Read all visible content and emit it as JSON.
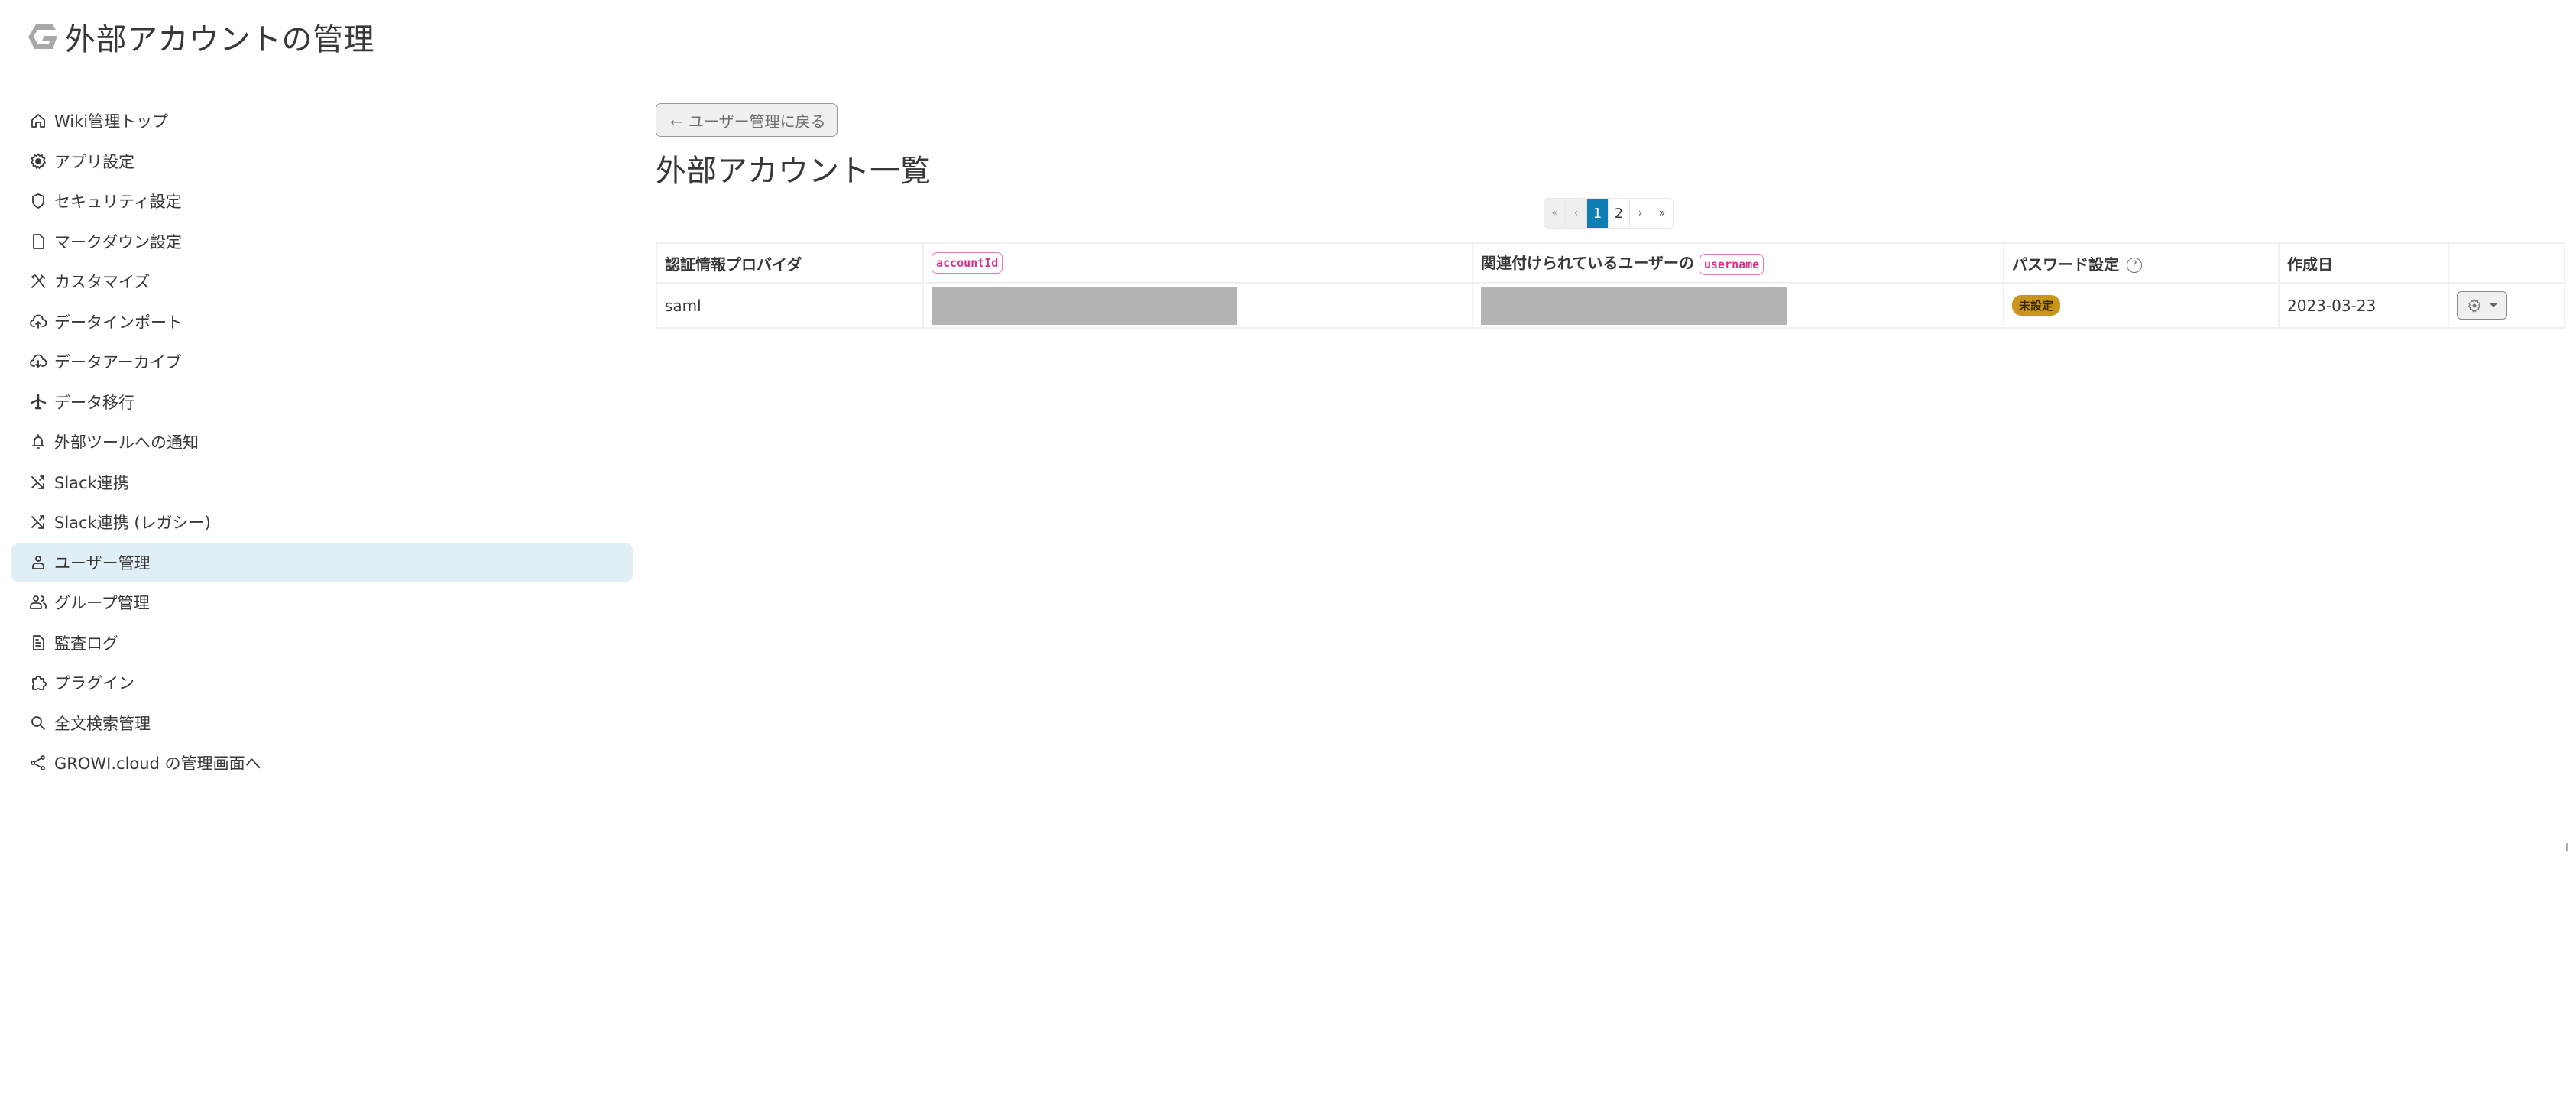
{
  "header": {
    "title": "外部アカウントの管理",
    "logo_icon": "growi-logo-icon"
  },
  "sidebar": {
    "items": [
      {
        "label": "Wiki管理トップ",
        "icon": "home-icon",
        "active": false
      },
      {
        "label": "アプリ設定",
        "icon": "gear-icon",
        "active": false
      },
      {
        "label": "セキュリティ設定",
        "icon": "shield-icon",
        "active": false
      },
      {
        "label": "マークダウン設定",
        "icon": "file-icon",
        "active": false
      },
      {
        "label": "カスタマイズ",
        "icon": "tools-icon",
        "active": false
      },
      {
        "label": "データインポート",
        "icon": "cloud-upload-icon",
        "active": false
      },
      {
        "label": "データアーカイブ",
        "icon": "cloud-download-icon",
        "active": false
      },
      {
        "label": "データ移行",
        "icon": "airplane-icon",
        "active": false
      },
      {
        "label": "外部ツールへの通知",
        "icon": "bell-icon",
        "active": false
      },
      {
        "label": "Slack連携",
        "icon": "shuffle-icon",
        "active": false
      },
      {
        "label": "Slack連携 (レガシー)",
        "icon": "shuffle-icon",
        "active": false
      },
      {
        "label": "ユーザー管理",
        "icon": "person-icon",
        "active": true
      },
      {
        "label": "グループ管理",
        "icon": "people-icon",
        "active": false
      },
      {
        "label": "監査ログ",
        "icon": "document-icon",
        "active": false
      },
      {
        "label": "プラグイン",
        "icon": "puzzle-icon",
        "active": false
      },
      {
        "label": "全文検索管理",
        "icon": "search-icon",
        "active": false
      },
      {
        "label": "GROWI.cloud の管理画面へ",
        "icon": "share-icon",
        "active": false
      }
    ]
  },
  "main": {
    "back_button": {
      "arrow": "←",
      "label": "ユーザー管理に戻る"
    },
    "title": "外部アカウント一覧",
    "pagination": {
      "first": "«",
      "prev": "‹",
      "pages": [
        "1",
        "2"
      ],
      "current": "1",
      "next": "›",
      "last": "»"
    },
    "table": {
      "headers": {
        "provider": "認証情報プロバイダ",
        "account_id": "accountId",
        "username_prefix": "関連付けられているユーザーの",
        "username": "username",
        "password": "パスワード設定",
        "password_help": "?",
        "created": "作成日",
        "actions": ""
      },
      "rows": [
        {
          "provider": "saml",
          "account_id": "[redacted]",
          "username": "[redacted]",
          "password_status": "未設定",
          "created": "2023-03-23"
        }
      ]
    }
  },
  "colors": {
    "active_nav_bg": "#e0eff6",
    "pagination_active": "#0e7eb5",
    "code_badge": "#d6338a",
    "status_badge": "#c9951a"
  }
}
